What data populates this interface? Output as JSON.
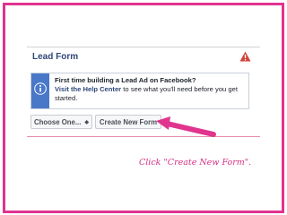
{
  "section": {
    "title": "Lead Form"
  },
  "icons": {
    "warning": "warning-triangle-icon",
    "info": "info-icon",
    "caret": "up-down-caret-icon"
  },
  "info_box": {
    "title": "First time building a Lead Ad on Facebook?",
    "link_text": "Visit the Help Center",
    "body_text": " to see what you'll need before you get started."
  },
  "buttons": {
    "choose_label": "Choose One...",
    "choose_caret": "◆",
    "create_label": "Create New Form"
  },
  "caption": "Click \"Create New Form\".",
  "colors": {
    "frame": "#e0348f",
    "title": "#2f4778",
    "info_accent": "#4a78c9",
    "warning": "#d0413a",
    "arrow": "#e0348f"
  }
}
